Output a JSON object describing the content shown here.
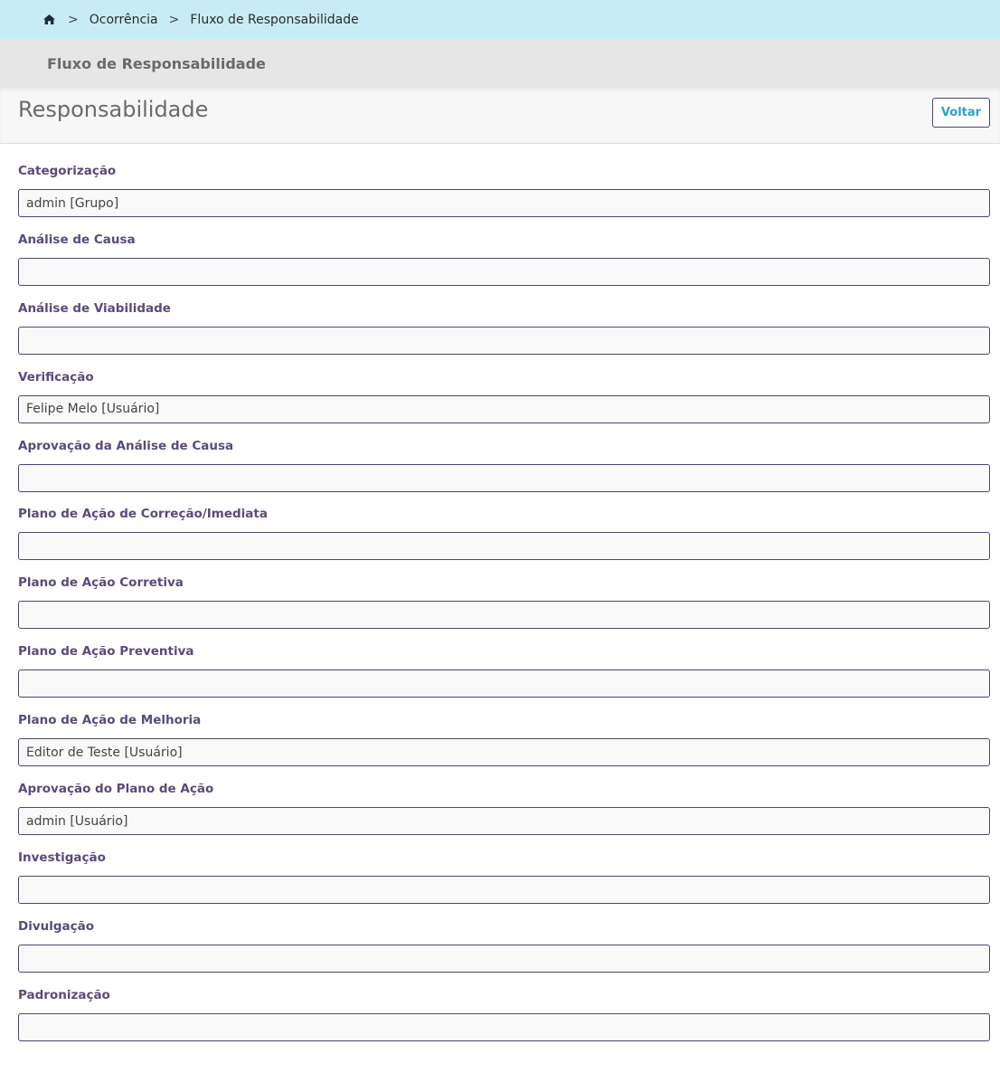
{
  "breadcrumb": {
    "home_icon": "home-icon",
    "separator": ">",
    "items": [
      "Ocorrência",
      "Fluxo de Responsabilidade"
    ]
  },
  "section_header": {
    "title": "Fluxo de Responsabilidade"
  },
  "panel": {
    "title": "Responsabilidade",
    "back_label": "Voltar"
  },
  "colors": {
    "breadcrumb_bg": "#c7ecf5",
    "label": "#5b4a7a",
    "button_text": "#2aa3c4",
    "input_border": "#4e4670"
  },
  "fields": [
    {
      "label": "Categorização",
      "value": "admin [Grupo]"
    },
    {
      "label": "Análise de Causa",
      "value": ""
    },
    {
      "label": "Análise de Viabilidade",
      "value": ""
    },
    {
      "label": "Verificação",
      "value": "Felipe Melo [Usuário]"
    },
    {
      "label": "Aprovação da Análise de Causa",
      "value": ""
    },
    {
      "label": "Plano de Ação de Correção/Imediata",
      "value": ""
    },
    {
      "label": "Plano de Ação Corretiva",
      "value": ""
    },
    {
      "label": "Plano de Ação Preventiva",
      "value": ""
    },
    {
      "label": "Plano de Ação de Melhoria",
      "value": "Editor de Teste [Usuário]"
    },
    {
      "label": "Aprovação do Plano de Ação",
      "value": "admin [Usuário]"
    },
    {
      "label": "Investigação",
      "value": ""
    },
    {
      "label": "Divulgação",
      "value": ""
    },
    {
      "label": "Padronização",
      "value": ""
    }
  ]
}
